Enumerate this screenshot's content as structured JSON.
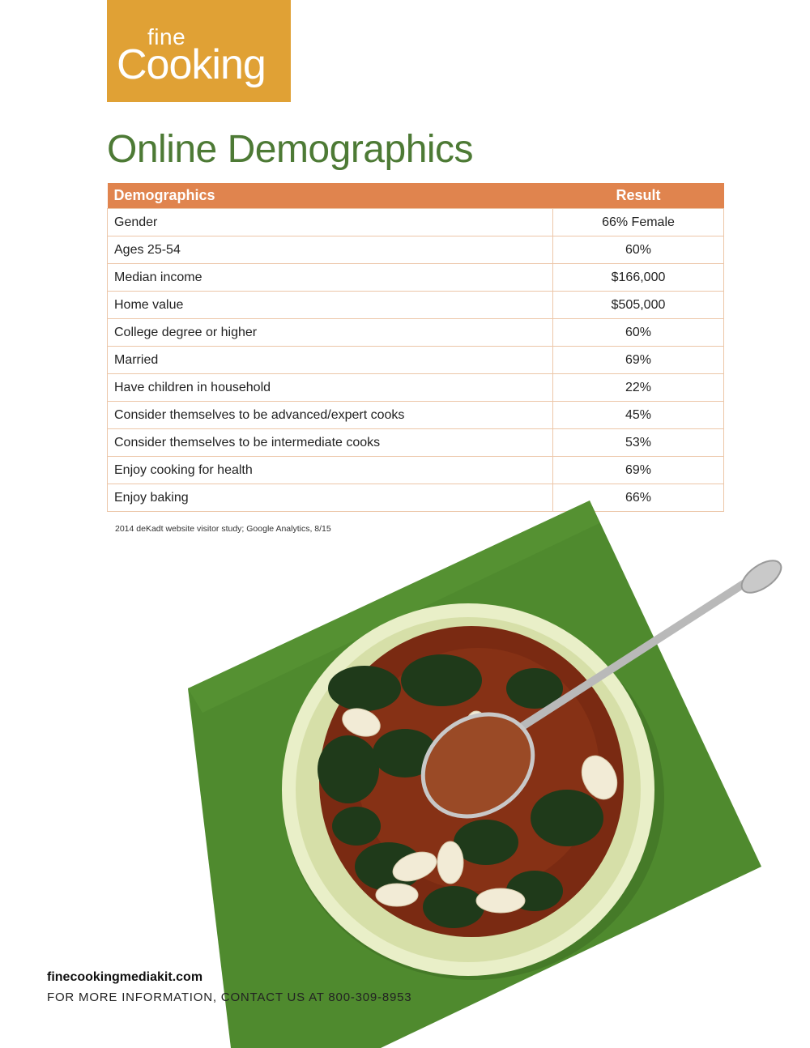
{
  "logo": {
    "line1": "fine",
    "line2": "Cooking",
    "color": "#e0a135"
  },
  "title": "Online Demographics",
  "table": {
    "headers": [
      "Demographics",
      "Result"
    ],
    "rows": [
      [
        "Gender",
        "66% Female"
      ],
      [
        "Ages 25-54",
        "60%"
      ],
      [
        "Median income",
        "$166,000"
      ],
      [
        "Home value",
        "$505,000"
      ],
      [
        "College degree or higher",
        "60%"
      ],
      [
        "Married",
        "69%"
      ],
      [
        "Have children in household",
        "22%"
      ],
      [
        "Consider themselves to be advanced/expert cooks",
        "45%"
      ],
      [
        "Consider themselves to be intermediate cooks",
        "53%"
      ],
      [
        "Enjoy cooking for health",
        "69%"
      ],
      [
        "Enjoy baking",
        "66%"
      ]
    ],
    "header_color": "#e0844e"
  },
  "footnote": "2014 deKadt website visitor study; Google Analytics, 8/15",
  "footer": {
    "url": "finecookingmediakit.com",
    "contact": "FOR MORE INFORMATION, CONTACT US AT 800-309-8953"
  },
  "colors": {
    "title_green": "#4d7a35",
    "napkin_green": "#4f8a2e"
  }
}
